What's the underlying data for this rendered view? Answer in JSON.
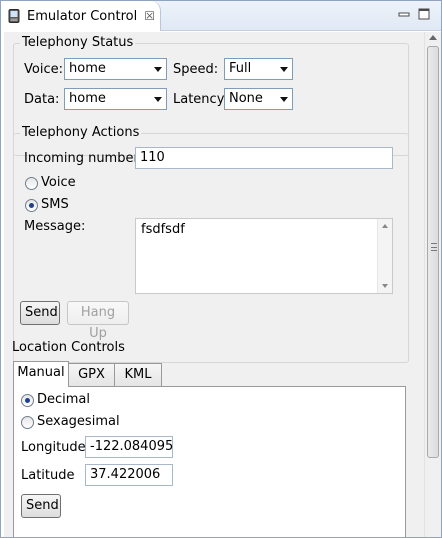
{
  "view": {
    "title": "Emulator Control",
    "icon": "emulator-icon",
    "close_glyph": "☒",
    "controls": [
      "minimize-icon",
      "maximize-icon"
    ]
  },
  "telephony_status": {
    "title": "Telephony Status",
    "voice_label": "Voice:",
    "voice_value": "home",
    "speed_label": "Speed:",
    "speed_value": "Full",
    "data_label": "Data:",
    "data_value": "home",
    "latency_label": "Latency:",
    "latency_value": "None"
  },
  "telephony_actions": {
    "title": "Telephony Actions",
    "incoming_label": "Incoming number:",
    "incoming_value": "110",
    "voice_option": "Voice",
    "sms_option": "SMS",
    "selected": "SMS",
    "message_label": "Message:",
    "message_value": "fsdfsdf",
    "send_label": "Send",
    "hangup_label": "Hang Up"
  },
  "location": {
    "title": "Location Controls",
    "tabs": [
      {
        "label": "Manual",
        "active": true
      },
      {
        "label": "GPX",
        "active": false
      },
      {
        "label": "KML",
        "active": false
      }
    ],
    "decimal_label": "Decimal",
    "sexagesimal_label": "Sexagesimal",
    "selected": "Decimal",
    "longitude_label": "Longitude",
    "longitude_value": "-122.084095",
    "latitude_label": "Latitude",
    "latitude_value": "37.422006",
    "send_label": "Send"
  },
  "colors": {
    "tab_border": "#8ea4c1",
    "panel_bg": "#f0f0f0",
    "radio_dot": "#1f3f8f"
  }
}
